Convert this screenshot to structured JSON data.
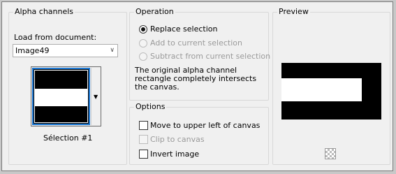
{
  "alpha": {
    "title": "Alpha channels",
    "load_label": "Load from document:",
    "document_value": "Image49",
    "selection_label": "Sélection #1"
  },
  "operation": {
    "title": "Operation",
    "options": [
      {
        "label": "Replace selection",
        "selected": true,
        "enabled": true
      },
      {
        "label": "Add to current selection",
        "selected": false,
        "enabled": false
      },
      {
        "label": "Subtract from current selection",
        "selected": false,
        "enabled": false
      }
    ],
    "message": "The original alpha channel rectangle completely intersects the canvas."
  },
  "options": {
    "title": "Options",
    "checks": [
      {
        "label": "Move to upper left of canvas",
        "checked": false,
        "enabled": true
      },
      {
        "label": "Clip to canvas",
        "checked": false,
        "enabled": false
      },
      {
        "label": "Invert image",
        "checked": false,
        "enabled": true
      }
    ]
  },
  "preview": {
    "title": "Preview"
  }
}
